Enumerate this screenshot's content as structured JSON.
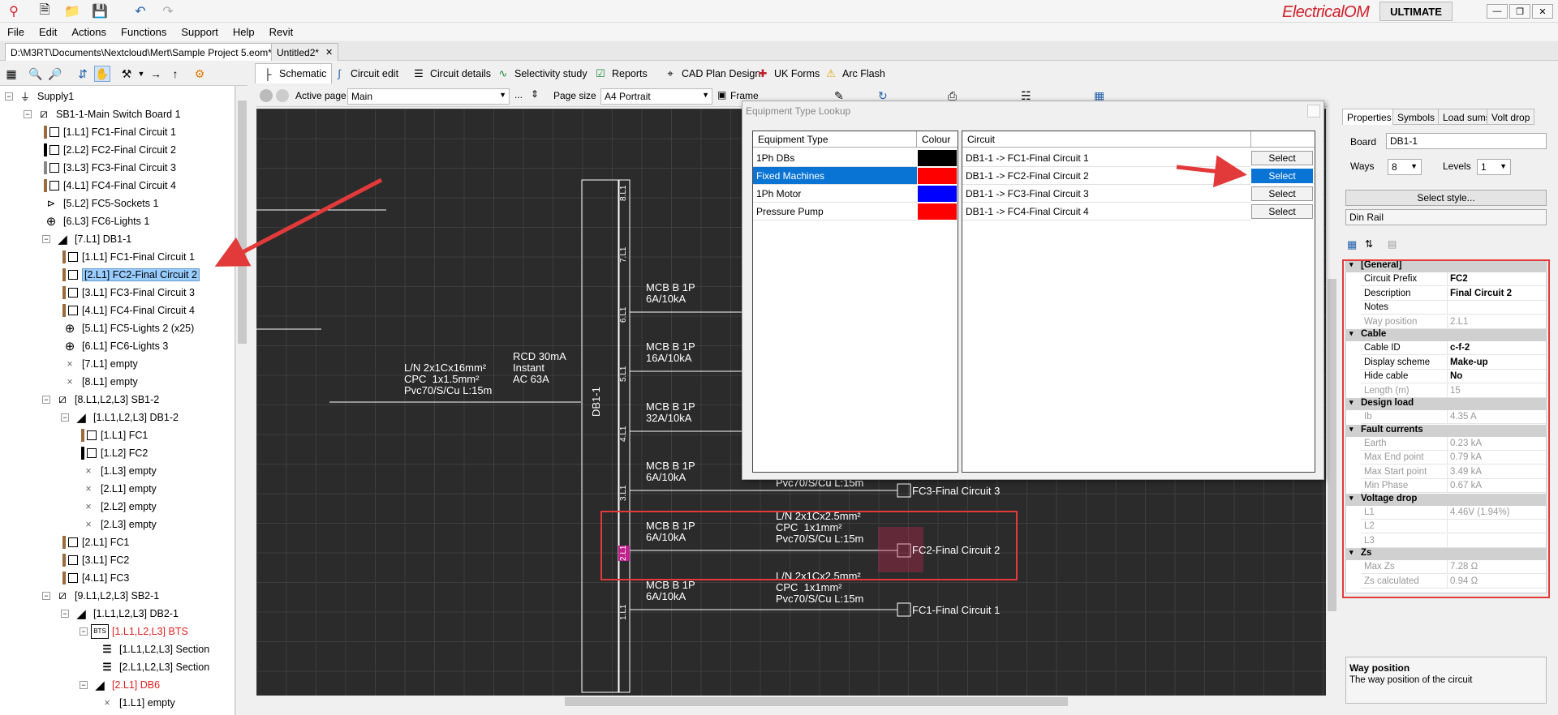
{
  "app": {
    "brand": "ElectricalOM",
    "edition": "ULTIMATE"
  },
  "menu": [
    "File",
    "Edit",
    "Actions",
    "Functions",
    "Support",
    "Help",
    "Revit"
  ],
  "doc_tabs": [
    {
      "label": "D:\\M3RT\\Documents\\Nextcloud\\Mert\\Sample Project 5.eom*"
    },
    {
      "label": "Untitled2*"
    }
  ],
  "view_tabs": [
    {
      "label": "Schematic",
      "icon": "schematic-icon"
    },
    {
      "label": "Circuit edit",
      "icon": "circuit-edit-icon"
    },
    {
      "label": "Circuit details",
      "icon": "list-icon"
    },
    {
      "label": "Selectivity study",
      "icon": "curve-icon"
    },
    {
      "label": "Reports",
      "icon": "check-icon"
    },
    {
      "label": "CAD Plan Design",
      "icon": "cad-icon"
    },
    {
      "label": "UK Forms",
      "icon": "uk-flag-icon"
    },
    {
      "label": "Arc Flash",
      "icon": "warning-icon"
    }
  ],
  "page_toolbar": {
    "active_page_label": "Active page",
    "active_page_value": "Main",
    "ellipsis": "...",
    "page_size_label": "Page size",
    "page_size_value": "A4 Portrait",
    "frame_label": "Frame"
  },
  "tree": [
    {
      "label": "Supply1",
      "sym": "supply"
    },
    {
      "label": "SB1-1-Main Switch Board 1",
      "sym": "board"
    },
    {
      "label": "[1.L1] FC1-Final Circuit 1",
      "sym": "box-brown"
    },
    {
      "label": "[2.L2] FC2-Final Circuit 2",
      "sym": "box-black"
    },
    {
      "label": "[3.L3] FC3-Final Circuit 3",
      "sym": "box-grey"
    },
    {
      "label": "[4.L1] FC4-Final Circuit 4",
      "sym": "box-brown"
    },
    {
      "label": "[5.L2] FC5-Sockets 1",
      "sym": "socket"
    },
    {
      "label": "[6.L3] FC6-Lights 1",
      "sym": "light"
    },
    {
      "label": "[7.L1] DB1-1",
      "sym": "db"
    },
    {
      "label": "[1.L1] FC1-Final Circuit 1",
      "sym": "box-brown"
    },
    {
      "label": "[2.L1] FC2-Final Circuit 2",
      "sym": "box-brown",
      "selected": true
    },
    {
      "label": "[3.L1] FC3-Final Circuit 3",
      "sym": "box-brown"
    },
    {
      "label": "[4.L1] FC4-Final Circuit 4",
      "sym": "box-brown"
    },
    {
      "label": "[5.L1] FC5-Lights 2 (x25)",
      "sym": "light"
    },
    {
      "label": "[6.L1] FC6-Lights 3",
      "sym": "light"
    },
    {
      "label": "[7.L1] empty",
      "sym": "empty"
    },
    {
      "label": "[8.L1] empty",
      "sym": "empty"
    },
    {
      "label": "[8.L1,L2,L3] SB1-2",
      "sym": "board"
    },
    {
      "label": "[1.L1,L2,L3] DB1-2",
      "sym": "db"
    },
    {
      "label": "[1.L1] FC1",
      "sym": "box-brown"
    },
    {
      "label": "[1.L2] FC2",
      "sym": "box-black"
    },
    {
      "label": "[1.L3] empty",
      "sym": "empty"
    },
    {
      "label": "[2.L1] empty",
      "sym": "empty"
    },
    {
      "label": "[2.L2] empty",
      "sym": "empty"
    },
    {
      "label": "[2.L3] empty",
      "sym": "empty"
    },
    {
      "label": "[2.L1] FC1",
      "sym": "box-brown"
    },
    {
      "label": "[3.L1] FC2",
      "sym": "box-brown"
    },
    {
      "label": "[4.L1] FC3",
      "sym": "box-brown"
    },
    {
      "label": "[9.L1,L2,L3] SB2-1",
      "sym": "board"
    },
    {
      "label": "[1.L1,L2,L3] DB2-1",
      "sym": "db"
    },
    {
      "label": "[1.L1,L2,L3] BTS",
      "sym": "bts",
      "red": true
    },
    {
      "label": "[1.L1,L2,L3] Section",
      "sym": "section"
    },
    {
      "label": "[2.L1,L2,L3] Section",
      "sym": "section"
    },
    {
      "label": "[2.L1] DB6",
      "sym": "db",
      "red": true
    },
    {
      "label": "[1.L1] empty",
      "sym": "empty"
    }
  ],
  "schematic": {
    "db_label": "DB1-1",
    "way_tags": [
      "8.L1",
      "7.L1",
      "6.L1",
      "5.L1",
      "4.L1",
      "3.L1",
      "2.L1",
      "1.L1"
    ],
    "incomer": {
      "cable": "L/N 2x1Cx16mm²\nCPC  1x1.5mm²\nPvc70/S/Cu L:15m",
      "rcd": "RCD 30mA\nInstant\nAC 63A"
    },
    "breakers": [
      {
        "text": "MCB B 1P\n6A/10kA"
      },
      {
        "text": "MCB B 1P\n16A/10kA"
      },
      {
        "text": "MCB B 1P\n32A/10kA"
      },
      {
        "text": "MCB B 1P\n6A/10kA"
      },
      {
        "text": "MCB B 1P\n6A/10kA"
      },
      {
        "text": "MCB B 1P\n6A/10kA"
      }
    ],
    "cable_fc3_partial": "Pvc70/S/Cu L:15m",
    "cable_fc2": "L/N 2x1Cx2.5mm²\nCPC  1x1mm²\nPvc70/S/Cu L:15m",
    "cable_fc1": "L/N 2x1Cx2.5mm²\nCPC  1x1mm²\nPvc70/S/Cu L:15m",
    "loads": [
      "FC3-Final Circuit 3",
      "FC2-Final Circuit 2",
      "FC1-Final Circuit 1"
    ]
  },
  "dialog": {
    "title": "Equipment Type Lookup",
    "col_equipment": "Equipment Type",
    "col_colour": "Colour",
    "col_circuit": "Circuit",
    "equipment": [
      {
        "name": "1Ph DBs",
        "colour": "#000000"
      },
      {
        "name": "Fixed Machines",
        "colour": "#ff0000",
        "selected": true
      },
      {
        "name": "1Ph Motor",
        "colour": "#0000ff"
      },
      {
        "name": "Pressure Pump",
        "colour": "#ff0000"
      }
    ],
    "circuits": [
      {
        "name": "DB1-1 -> FC1-Final Circuit 1",
        "button": "Select"
      },
      {
        "name": "DB1-1 -> FC2-Final Circuit 2",
        "button": "Select",
        "active": true
      },
      {
        "name": "DB1-1 -> FC3-Final Circuit 3",
        "button": "Select"
      },
      {
        "name": "DB1-1 -> FC4-Final Circuit 4",
        "button": "Select"
      }
    ]
  },
  "right_panel": {
    "tabs": [
      "Properties",
      "Symbols",
      "Load sums",
      "Volt drop"
    ],
    "board_label": "Board",
    "board_value": "DB1-1",
    "ways_label": "Ways",
    "ways_value": "8",
    "levels_label": "Levels",
    "levels_value": "1",
    "select_style": "Select style...",
    "style_value": "Din Rail",
    "categories": [
      {
        "title": "[General]",
        "rows": [
          {
            "k": "Circuit Prefix",
            "v": "FC2",
            "bold": true
          },
          {
            "k": "Description",
            "v": "Final Circuit 2",
            "bold": true
          },
          {
            "k": "Notes",
            "v": ""
          },
          {
            "k": "Way position",
            "v": "2.L1",
            "ro": true
          }
        ]
      },
      {
        "title": "Cable",
        "rows": [
          {
            "k": "Cable ID",
            "v": "c-f-2",
            "bold": true
          },
          {
            "k": "Display scheme",
            "v": "Make-up",
            "bold": true
          },
          {
            "k": "Hide cable",
            "v": "No",
            "bold": true
          },
          {
            "k": "Length (m)",
            "v": "15",
            "ro": true
          }
        ]
      },
      {
        "title": "Design load",
        "rows": [
          {
            "k": "Ib",
            "v": "4.35 A",
            "ro": true
          }
        ]
      },
      {
        "title": "Fault currents",
        "rows": [
          {
            "k": "Earth",
            "v": "0.23 kA",
            "ro": true
          },
          {
            "k": "Max End point",
            "v": "0.79 kA",
            "ro": true
          },
          {
            "k": "Max Start point",
            "v": "3.49 kA",
            "ro": true
          },
          {
            "k": "Min Phase",
            "v": "0.67 kA",
            "ro": true
          }
        ]
      },
      {
        "title": "Voltage drop",
        "rows": [
          {
            "k": "L1",
            "v": "4.46V (1.94%)",
            "ro": true
          },
          {
            "k": "L2",
            "v": "",
            "ro": true
          },
          {
            "k": "L3",
            "v": "",
            "ro": true
          }
        ]
      },
      {
        "title": "Zs",
        "rows": [
          {
            "k": "Max Zs",
            "v": "7.28 Ω",
            "ro": true
          },
          {
            "k": "Zs calculated",
            "v": "0.94 Ω",
            "ro": true
          }
        ]
      }
    ],
    "help_title": "Way position",
    "help_text": "The way position of the circuit"
  },
  "colors": {
    "annotation": "#e23a3a",
    "selection": "#0a74d4",
    "canvas": "#2b2b2b"
  }
}
